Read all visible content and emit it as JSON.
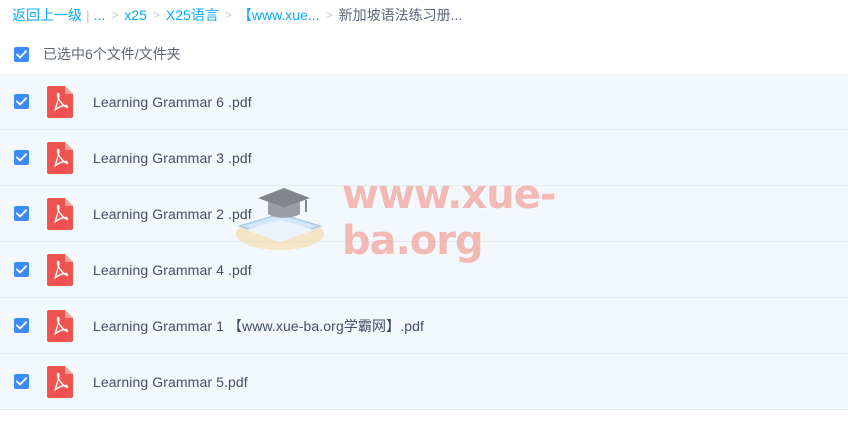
{
  "breadcrumb": {
    "back": "返回上一级",
    "ellipsis": "...",
    "items": [
      "x25",
      "X25语言",
      "【www.xue..."
    ],
    "current": "新加坡语法练习册..."
  },
  "selection": {
    "text": "已选中6个文件/文件夹"
  },
  "files": [
    {
      "name": "Learning Grammar 6 .pdf",
      "checked": true,
      "icon": "pdf-icon"
    },
    {
      "name": "Learning Grammar 3 .pdf",
      "checked": true,
      "icon": "pdf-icon"
    },
    {
      "name": "Learning Grammar 2 .pdf",
      "checked": true,
      "icon": "pdf-icon"
    },
    {
      "name": "Learning Grammar 4 .pdf",
      "checked": true,
      "icon": "pdf-icon"
    },
    {
      "name": "Learning Grammar 1 【www.xue-ba.org学霸网】.pdf",
      "checked": true,
      "icon": "pdf-icon"
    },
    {
      "name": "Learning Grammar 5.pdf",
      "checked": true,
      "icon": "pdf-icon"
    }
  ],
  "watermark": {
    "text": "www.xue-ba.org",
    "icon": "graduation-cap-book-icon"
  },
  "colors": {
    "accent": "#3b8cff",
    "link": "#09aaff",
    "pdf": "#f0524f",
    "row_bg": "#f3f8fd"
  }
}
